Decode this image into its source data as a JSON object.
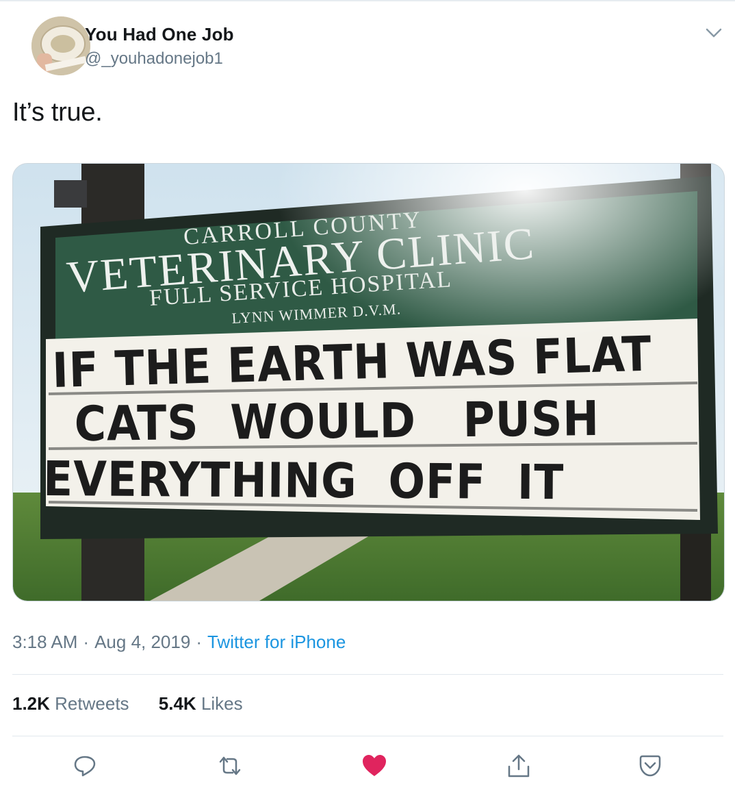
{
  "author": {
    "name": "You Had One Job",
    "handle": "@_youhadonejob1"
  },
  "tweet": {
    "text": "It’s true."
  },
  "photo": {
    "sign": {
      "line1": "CARROLL COUNTY",
      "line2": "VETERINARY CLINIC",
      "line3": "FULL SERVICE HOSPITAL",
      "line4": "LYNN WIMMER D.V.M.",
      "marquee": [
        "IF THE EARTH WAS FLAT",
        "CATS  WOULD   PUSH",
        "EVERYTHING  OFF  IT"
      ]
    }
  },
  "meta": {
    "time": "3:18 AM",
    "date": "Aug 4, 2019",
    "separator": "·",
    "source": "Twitter for iPhone"
  },
  "stats": {
    "retweets_count": "1.2K",
    "retweets_label": "Retweets",
    "likes_count": "5.4K",
    "likes_label": "Likes"
  },
  "icons": {
    "reply": "reply-icon",
    "retweet": "retweet-icon",
    "like": "heart-icon",
    "share": "share-icon",
    "pocket": "pocket-icon",
    "more": "chevron-down-icon"
  },
  "colors": {
    "link": "#1b95e0",
    "like": "#e0245e",
    "secondary_text": "#657786",
    "sign_green": "#2f5a45"
  }
}
